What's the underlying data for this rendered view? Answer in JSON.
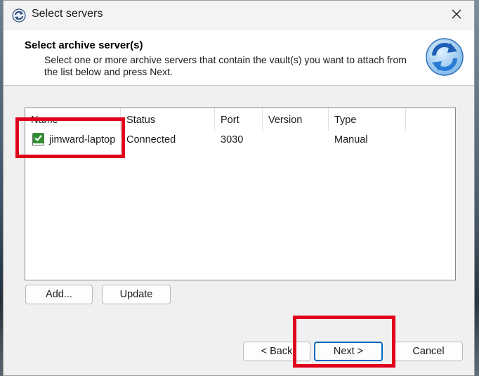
{
  "window": {
    "title": "Select servers",
    "close_label": "✕"
  },
  "header": {
    "title": "Select archive server(s)",
    "description": "Select one or more archive servers that contain the vault(s) you want to attach from the list below and press Next."
  },
  "list": {
    "columns": [
      "Name",
      "Status",
      "Port",
      "Version",
      "Type"
    ],
    "rows": [
      {
        "checked": true,
        "name": "jimward-laptop",
        "status": "Connected",
        "port": "3030",
        "version": "",
        "type": "Manual"
      }
    ]
  },
  "buttons": {
    "add": "Add...",
    "update": "Update",
    "back": "< Back",
    "next": "Next >",
    "cancel": "Cancel"
  },
  "colors": {
    "highlight": "#e0001b",
    "default_button_border": "#0067c0",
    "checkmark": "#2f8f2f"
  },
  "icons": {
    "app": "refresh-sync-icon",
    "header": "refresh-sync-icon",
    "close": "close-icon",
    "check": "checkmark-icon"
  }
}
